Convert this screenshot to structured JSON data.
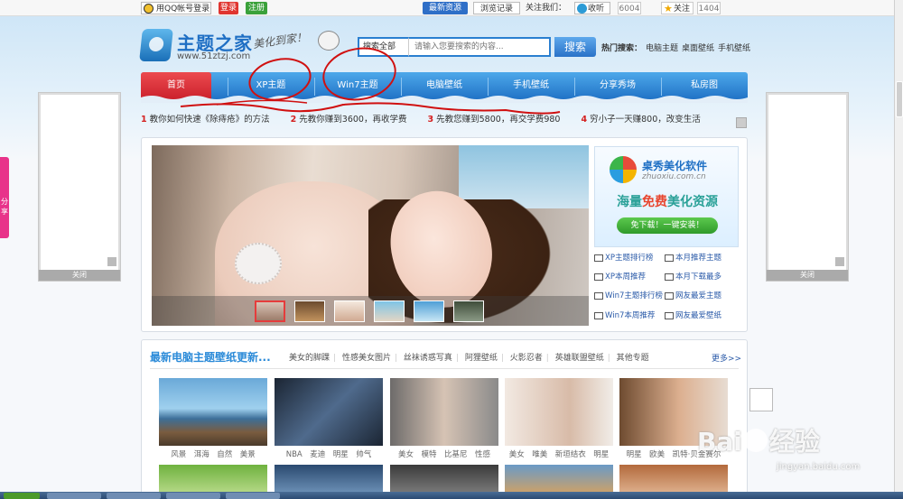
{
  "topbar": {
    "qq_login": "用QQ帐号登录",
    "login": "登录",
    "register": "注册",
    "latest": "最新资源",
    "history": "浏览记录",
    "follow_label": "关注我们：",
    "listen": "收听",
    "listen_count": "6004",
    "star": "关注",
    "star_count": "1404"
  },
  "logo": {
    "title": "主题之家",
    "url": "www.51ztzj.com",
    "slogan": "美化到家！"
  },
  "search": {
    "category": "搜索全部",
    "placeholder": "请输入您要搜索的内容...",
    "button": "搜索"
  },
  "hot_search": {
    "label": "热门搜索：",
    "items": [
      "电脑主题",
      "桌面壁纸",
      "手机壁纸"
    ]
  },
  "nav": {
    "items": [
      "首页",
      "XP主题",
      "Win7主题",
      "电脑壁纸",
      "手机壁纸",
      "分享秀场",
      "私房图"
    ]
  },
  "ticker": [
    {
      "n": "1",
      "t": "教你如何快速《除痔疮》的方法"
    },
    {
      "n": "2",
      "t": "先教你赚到3600，再收学费"
    },
    {
      "n": "3",
      "t": "先教您赚到5800，再交学费980"
    },
    {
      "n": "4",
      "t": "穷小子一天赚800，改变生活"
    }
  ],
  "side": {
    "close": "关闭",
    "share": "分享"
  },
  "promo": {
    "name": "桌秀美化软件",
    "url": "zhuoxiu.com.cn",
    "slogan_a": "海量",
    "slogan_b": "免费",
    "slogan_c": "美化资源",
    "button": "免下载！一键安装！"
  },
  "links": [
    "XP主题排行榜",
    "本月推荐主题",
    "XP本周推荐",
    "本月下载最多",
    "Win7主题排行榜",
    "网友最爱主题",
    "Win7本周推荐",
    "网友最爱壁纸"
  ],
  "section2": {
    "title": "最新电脑主题壁纸更新...",
    "cats": [
      "美女的脚踝",
      "性感美女图片",
      "丝袜诱惑写真",
      "阿狸壁纸",
      "火影忍者",
      "英雄联盟壁纸",
      "其他专题"
    ],
    "more": "更多>>",
    "captions": [
      "风景　洱海　自然　美景",
      "NBA　麦迪　明星　帅气",
      "美女　模特　比基尼　性感",
      "美女　唯美　新垣结衣　明星",
      "明星　欧美　凯特·贝金赛尔"
    ]
  },
  "watermark": {
    "brand": "Bai",
    "brand2": "经验",
    "url": "jingyan.baidu.com"
  }
}
